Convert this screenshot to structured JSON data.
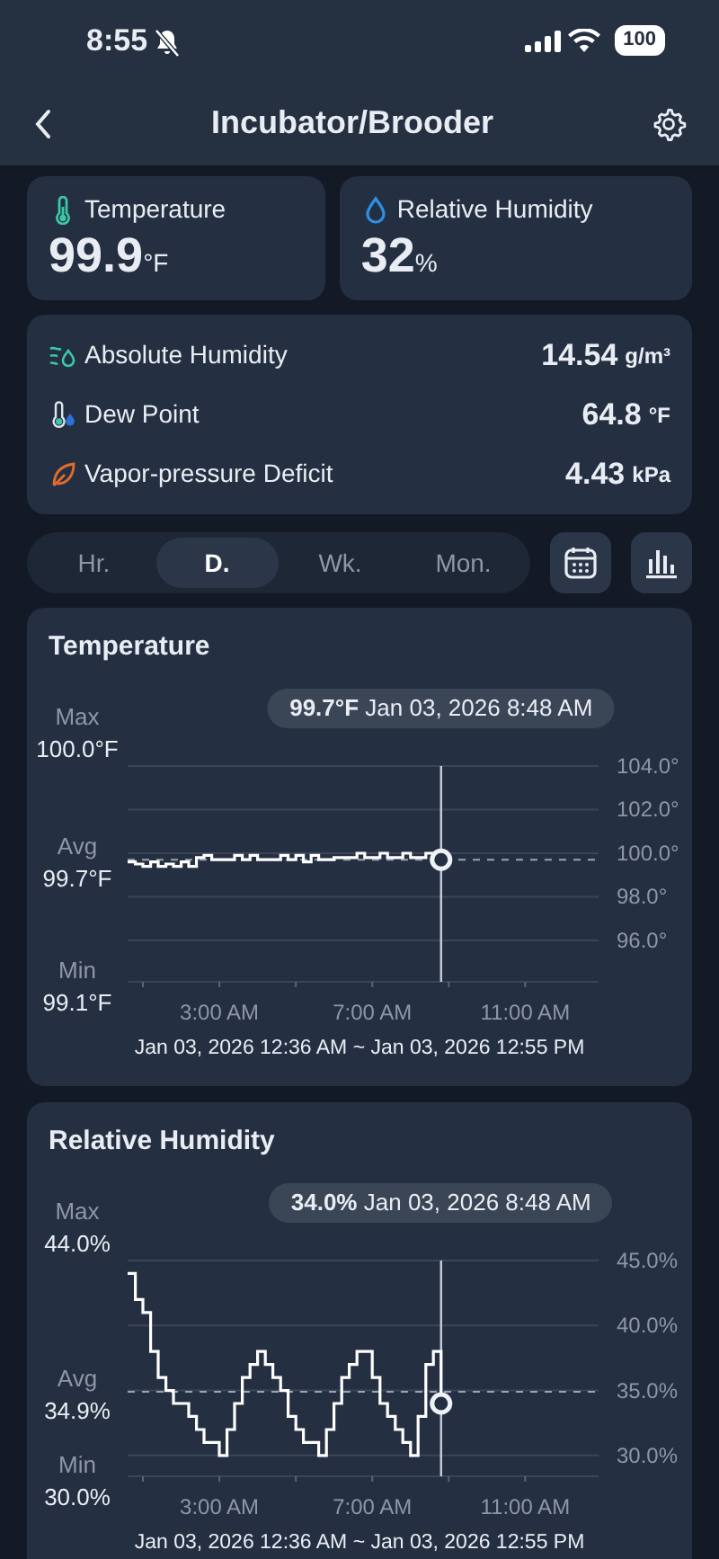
{
  "status_bar": {
    "time": "8:55",
    "battery": "100"
  },
  "header": {
    "title": "Incubator/Brooder"
  },
  "primary_metrics": [
    {
      "kind": "temperature",
      "label": "Temperature",
      "value": "99.9",
      "unit": "°F"
    },
    {
      "kind": "humidity",
      "label": "Relative Humidity",
      "value": "32",
      "unit": "%"
    }
  ],
  "secondary_metrics": [
    {
      "kind": "absolute-humidity",
      "label": "Absolute Humidity",
      "value": "14.54",
      "unit": "g/m³"
    },
    {
      "kind": "dew-point",
      "label": "Dew Point",
      "value": "64.8",
      "unit": "°F"
    },
    {
      "kind": "vpd",
      "label": "Vapor-pressure Deficit",
      "value": "4.43",
      "unit": "kPa"
    }
  ],
  "period_tabs": [
    {
      "label": "Hr.",
      "selected": false
    },
    {
      "label": "D.",
      "selected": true
    },
    {
      "label": "Wk.",
      "selected": false
    },
    {
      "label": "Mon.",
      "selected": false
    }
  ],
  "charts": [
    {
      "tooltip": "**99.7°F** Jan 03, 2026 8:48 AM",
      "stats": [
        {
          "kind": "max",
          "label": "Max",
          "value": "100.0°F"
        },
        {
          "kind": "avg",
          "label": "Avg",
          "value": "99.7°F"
        },
        {
          "kind": "min",
          "label": "Min",
          "value": "99.1°F"
        }
      ],
      "range": "Jan 03, 2026 12:36 AM ~ Jan 03, 2026 12:55 PM",
      "chart_data": {
        "type": "line",
        "title": "Temperature",
        "grid": true,
        "x": [
          0.6,
          0.8,
          0.8,
          1.0,
          1.0,
          1.2,
          1.2,
          1.4,
          1.4,
          1.6,
          1.6,
          1.8,
          1.8,
          2.0,
          2.0,
          2.2,
          2.2,
          2.4,
          2.4,
          2.6,
          2.6,
          2.8,
          2.8,
          3.0,
          3.0,
          3.2,
          3.2,
          3.4,
          3.4,
          3.6,
          3.6,
          3.8,
          3.8,
          4.0,
          4.0,
          4.2,
          4.2,
          4.4,
          4.4,
          4.6,
          4.6,
          4.8,
          4.8,
          5.0,
          5.0,
          5.2,
          5.2,
          5.4,
          5.4,
          5.6,
          5.6,
          5.8,
          5.8,
          6.0,
          6.0,
          6.2,
          6.2,
          6.4,
          6.4,
          6.6,
          6.6,
          6.8,
          6.8,
          7.0,
          7.0,
          7.2,
          7.2,
          7.4,
          7.4,
          7.6,
          7.6,
          7.8,
          7.8,
          8.0,
          8.0,
          8.2,
          8.2,
          8.4,
          8.4,
          8.6,
          8.6,
          8.8,
          8.8
        ],
        "series": [
          {
            "color": "#ffffff",
            "values": [
              99.6,
              99.6,
              99.5,
              99.5,
              99.4,
              99.4,
              99.6,
              99.6,
              99.4,
              99.4,
              99.5,
              99.5,
              99.4,
              99.4,
              99.6,
              99.6,
              99.4,
              99.4,
              99.8,
              99.8,
              99.9,
              99.9,
              99.7,
              99.7,
              99.7,
              99.7,
              99.7,
              99.7,
              99.9,
              99.9,
              99.7,
              99.7,
              99.9,
              99.9,
              99.7,
              99.7,
              99.7,
              99.7,
              99.7,
              99.7,
              99.9,
              99.9,
              99.7,
              99.7,
              99.9,
              99.9,
              99.6,
              99.6,
              99.9,
              99.9,
              99.7,
              99.7,
              99.7,
              99.7,
              99.8,
              99.8,
              99.8,
              99.8,
              99.8,
              99.8,
              100.0,
              100.0,
              99.8,
              99.8,
              99.8,
              99.8,
              100.0,
              100.0,
              99.8,
              99.8,
              99.8,
              99.8,
              100.0,
              100.0,
              99.8,
              99.8,
              99.8,
              99.8,
              100.0,
              100.0,
              99.8,
              99.8,
              99.7
            ]
          }
        ],
        "xlim": [
          0.6,
          12.92
        ],
        "ylim": [
          94.1,
          104.0
        ],
        "xticks": [
          {
            "value": 3,
            "label": "3:00 AM"
          },
          {
            "value": 7,
            "label": "7:00 AM"
          },
          {
            "value": 11,
            "label": "11:00 AM"
          }
        ],
        "yticks": [
          {
            "value": 104,
            "label": "104.0°"
          },
          {
            "value": 102,
            "label": "102.0°"
          },
          {
            "value": 100,
            "label": "100.0°"
          },
          {
            "value": 98,
            "label": "98.0°"
          },
          {
            "value": 96,
            "label": "96.0°"
          }
        ],
        "ref_lines": [
          {
            "axis": "y",
            "value": 99.7
          },
          {
            "axis": "x",
            "value": 8.8
          }
        ]
      }
    },
    {
      "tooltip": "**34.0%** Jan 03, 2026 8:48 AM",
      "stats": [
        {
          "kind": "max",
          "label": "Max",
          "value": "44.0%"
        },
        {
          "kind": "avg",
          "label": "Avg",
          "value": "34.9%"
        },
        {
          "kind": "min",
          "label": "Min",
          "value": "30.0%"
        }
      ],
      "range": "Jan 03, 2026 12:36 AM ~ Jan 03, 2026 12:55 PM",
      "chart_data": {
        "type": "line",
        "title": "Relative Humidity",
        "grid": true,
        "x": [
          0.6,
          0.8,
          0.8,
          1.0,
          1.0,
          1.2,
          1.2,
          1.4,
          1.4,
          1.6,
          1.6,
          1.8,
          1.8,
          2.0,
          2.0,
          2.2,
          2.2,
          2.4,
          2.4,
          2.6,
          2.6,
          2.8,
          2.8,
          3.0,
          3.0,
          3.2,
          3.2,
          3.4,
          3.4,
          3.6,
          3.6,
          3.8,
          3.8,
          4.0,
          4.0,
          4.2,
          4.2,
          4.4,
          4.4,
          4.6,
          4.6,
          4.8,
          4.8,
          5.0,
          5.0,
          5.2,
          5.2,
          5.4,
          5.4,
          5.6,
          5.6,
          5.8,
          5.8,
          6.0,
          6.0,
          6.2,
          6.2,
          6.4,
          6.4,
          6.6,
          6.6,
          6.8,
          6.8,
          7.0,
          7.0,
          7.2,
          7.2,
          7.4,
          7.4,
          7.6,
          7.6,
          7.8,
          7.8,
          8.0,
          8.0,
          8.2,
          8.2,
          8.4,
          8.4,
          8.6,
          8.6,
          8.8,
          8.8
        ],
        "series": [
          {
            "color": "#ffffff",
            "values": [
              44,
              44,
              42,
              42,
              41,
              41,
              38,
              38,
              36,
              36,
              35,
              35,
              34,
              34,
              34,
              34,
              33,
              33,
              32,
              32,
              31,
              31,
              31,
              31,
              30,
              30,
              32,
              32,
              34,
              34,
              36,
              36,
              37,
              37,
              38,
              38,
              37,
              37,
              36,
              36,
              35,
              35,
              33,
              33,
              32,
              32,
              31,
              31,
              31,
              31,
              30,
              30,
              32,
              32,
              34,
              34,
              36,
              36,
              37,
              37,
              38,
              38,
              38,
              38,
              36,
              36,
              34,
              34,
              33,
              33,
              32,
              32,
              31,
              31,
              30,
              30,
              33,
              33,
              37,
              37,
              38,
              38,
              34
            ]
          }
        ],
        "xlim": [
          0.6,
          12.92
        ],
        "ylim": [
          28.4,
          45.0
        ],
        "xticks": [
          {
            "value": 3,
            "label": "3:00 AM"
          },
          {
            "value": 7,
            "label": "7:00 AM"
          },
          {
            "value": 11,
            "label": "11:00 AM"
          }
        ],
        "yticks": [
          {
            "value": 45,
            "label": "45.0%"
          },
          {
            "value": 40,
            "label": "40.0%"
          },
          {
            "value": 35,
            "label": "35.0%"
          },
          {
            "value": 30,
            "label": "30.0%"
          }
        ],
        "ref_lines": [
          {
            "axis": "y",
            "value": 34.9
          },
          {
            "axis": "x",
            "value": 8.8
          }
        ]
      }
    }
  ]
}
